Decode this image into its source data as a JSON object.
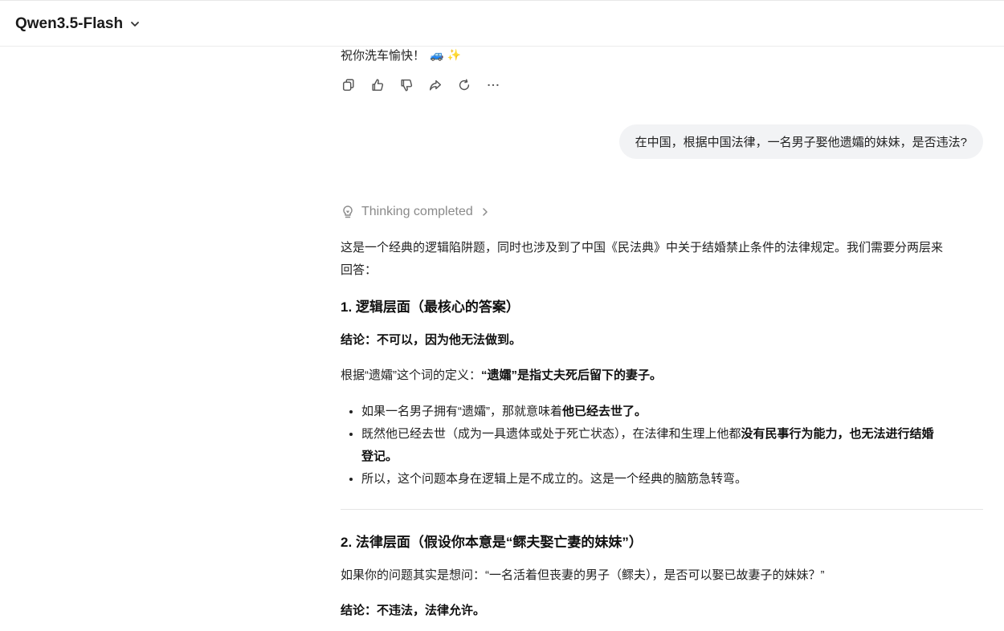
{
  "header": {
    "model_name": "Qwen3.5-Flash"
  },
  "previous_message": {
    "text": "祝你洗车愉快！",
    "emoji": "🚙 ✨"
  },
  "actions": [
    "copy-icon",
    "thumbs-up-icon",
    "thumbs-down-icon",
    "share-icon",
    "regenerate-icon",
    "more-icon"
  ],
  "user_message": "在中国，根据中国法律，一名男子娶他遗孀的妹妹，是否违法?",
  "thinking": {
    "label": "Thinking completed"
  },
  "answer": {
    "intro_line1": "这是一个经典的逻辑陷阱题，同时也涉及到了中国《民法典》中关于结婚禁止条件的法律规定。我们需要分两层来",
    "intro_line2": "回答：",
    "section1": {
      "heading": "1. 逻辑层面（最核心的答案）",
      "conclusion": "结论：不可以，因为他无法做到。",
      "def_prefix": "根据“遗孀”这个词的定义：",
      "def_bold": "“遗孀”是指丈夫死后留下的妻子。",
      "bullets": [
        {
          "normal": "如果一名男子拥有“遗孀”，那就意味着",
          "bold": "他已经去世了。"
        },
        {
          "normal": "既然他已经去世（成为一具遗体或处于死亡状态），在法律和生理上他都",
          "bold": "没有民事行为能力，也无法进行结婚",
          "bold2": "登记。"
        },
        {
          "normal": "所以，这个问题本身在逻辑上是不成立的。这是一个经典的脑筋急转弯。",
          "bold": ""
        }
      ]
    },
    "section2": {
      "heading": "2. 法律层面（假设你本意是“鳏夫娶亡妻的妹妹”）",
      "question": "如果你的问题其实是想问：“一名活着但丧妻的男子（鳏夫），是否可以娶已故妻子的妹妹？”",
      "conclusion": "结论：不违法，法律允许。"
    }
  }
}
